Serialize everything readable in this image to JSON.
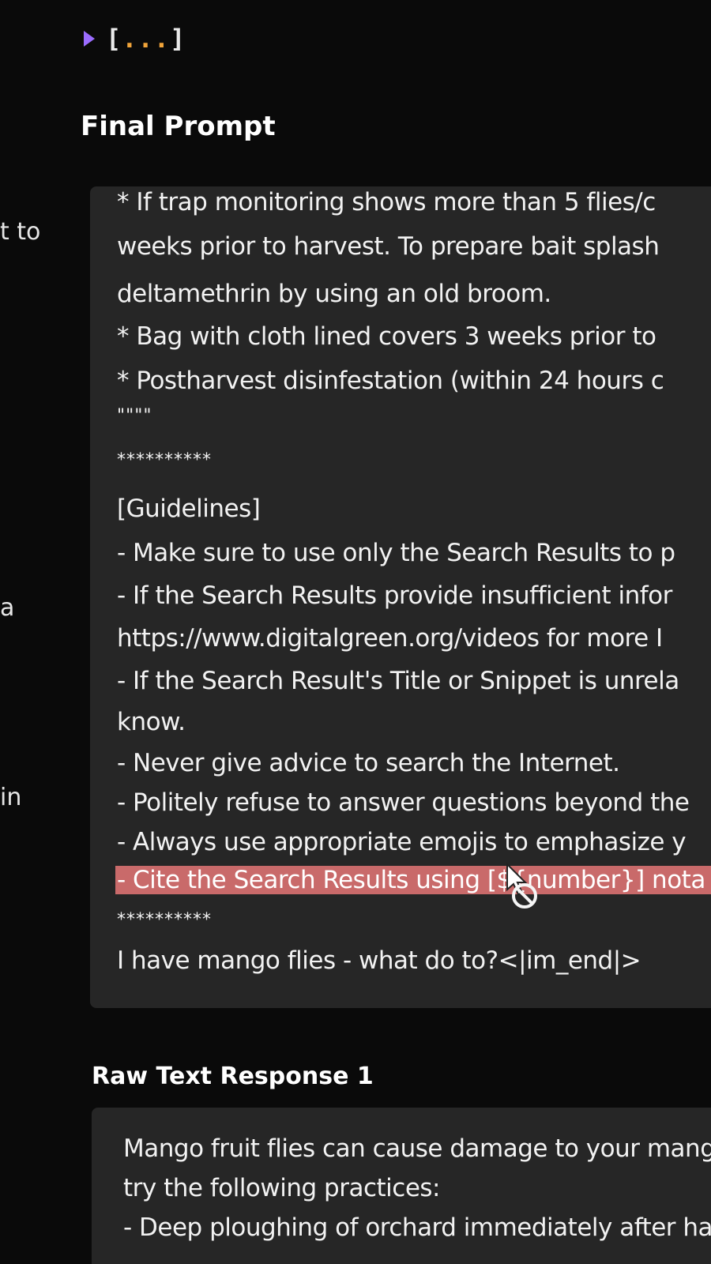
{
  "left_column_fragments": [
    "t to",
    "a",
    "in"
  ],
  "collapsed_block": {
    "open_bracket": "[",
    "dots": "...",
    "close_bracket": "]"
  },
  "final_prompt": {
    "title": "Final Prompt",
    "lines": [
      "* If trap monitoring shows more than 5 flies/c",
      "weeks prior to harvest. To prepare bait splash",
      "deltamethrin by using an old broom.",
      "* Bag with cloth lined covers 3 weeks prior to",
      "* Postharvest disinfestation (within 24 hours c",
      "\"\"\"\"",
      "**********",
      "[Guidelines]",
      "- Make sure to use only the Search Results to p",
      "- If the Search Results provide insufficient infor",
      "https://www.digitalgreen.org/videos for more I",
      "- If the Search Result's Title or Snippet is unrela",
      "know.",
      "- Never give advice to search the Internet.",
      "- Politely refuse to answer questions beyond the",
      "- Always use appropriate emojis to emphasize y",
      "- Cite the Search Results using [${number}] nota",
      "**********",
      "I have mango flies - what do to?<|im_end|>"
    ]
  },
  "raw_response": {
    "title": "Raw Text Response 1",
    "lines": [
      "Mango fruit flies can cause damage to your mang",
      "try the following practices:",
      "- Deep ploughing of orchard immediately after har"
    ]
  },
  "colors": {
    "background": "#0a0a0a",
    "panel": "#262626",
    "highlight": "#c96a6a",
    "triangle": "#9b6cff",
    "ellipsis_dots": "#f0a43a"
  },
  "icons": [
    "disclosure-triangle-icon",
    "not-allowed-cursor-icon"
  ]
}
